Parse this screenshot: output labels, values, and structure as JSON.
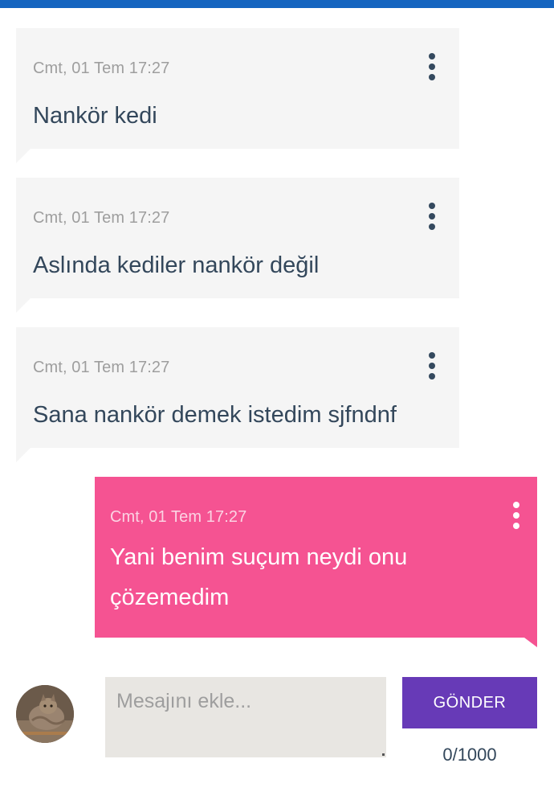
{
  "messages": [
    {
      "timestamp": "Cmt, 01 Tem 17:27",
      "text": "Nankör kedi",
      "direction": "incoming"
    },
    {
      "timestamp": "Cmt, 01 Tem 17:27",
      "text": "Aslında kediler nankör değil",
      "direction": "incoming"
    },
    {
      "timestamp": "Cmt, 01 Tem 17:27",
      "text": "Sana nankör demek istedim sjfndnf",
      "direction": "incoming"
    },
    {
      "timestamp": "Cmt, 01 Tem 17:27",
      "text": "Yani benim suçum neydi onu çözemedim",
      "direction": "outgoing"
    }
  ],
  "composer": {
    "placeholder": "Mesajını ekle...",
    "value": "",
    "send_label": "GÖNDER",
    "counter": "0/1000"
  },
  "colors": {
    "topbar": "#1565c0",
    "incoming_bubble": "#f5f5f5",
    "outgoing_bubble": "#f55392",
    "send_button": "#673ab7"
  },
  "icons": {
    "message_menu": "more-vertical-icon",
    "avatar": "user-avatar-cat"
  }
}
